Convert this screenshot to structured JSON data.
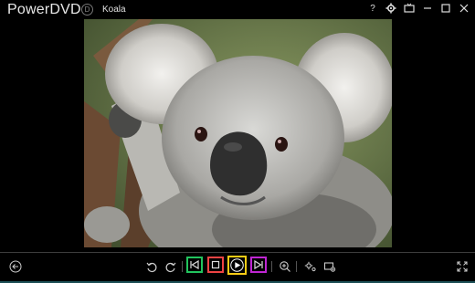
{
  "app": {
    "title": "PowerDVD",
    "badge": "D"
  },
  "file": {
    "title": "Koala"
  },
  "titlebar": {
    "help": "?"
  },
  "colors": {
    "highlight_previous": "#22c55e",
    "highlight_stop": "#ef4444",
    "highlight_play": "#facc15",
    "highlight_next": "#c026d3"
  },
  "controls": [
    "back-icon",
    "rotate-left-icon",
    "rotate-right-icon",
    "previous-icon",
    "stop-icon",
    "play-icon",
    "next-icon",
    "zoom-icon",
    "settings-icon",
    "snapshot-icon",
    "fullscreen-icon"
  ]
}
